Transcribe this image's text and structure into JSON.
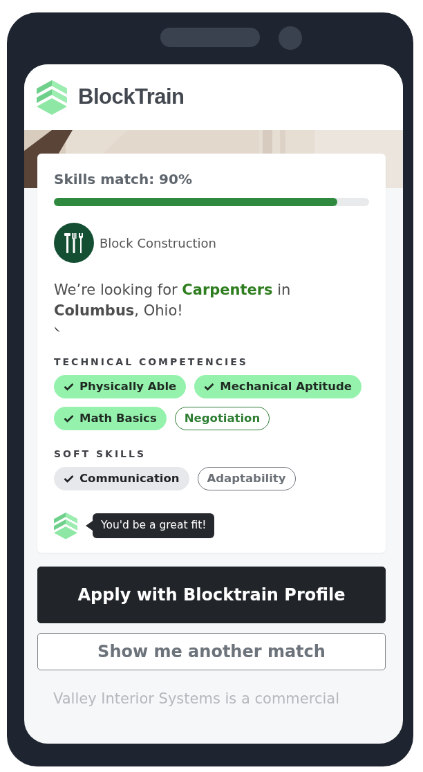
{
  "header": {
    "brand": "BlockTrain"
  },
  "match": {
    "label": "Skills match: 90%",
    "level": 0.9
  },
  "company": {
    "name": "Block Construction"
  },
  "headline": "We’re looking for **Carpenters** in **Columbus**, Ohio!",
  "sections": [
    {
      "kind": "technical",
      "title": "TECHNICAL COMPETENCIES",
      "skills": [
        {
          "label": "Physically Able",
          "checked": true
        },
        {
          "label": "Mechanical Aptitude",
          "checked": true
        },
        {
          "label": "Math Basics",
          "checked": true
        },
        {
          "label": "Negotiation",
          "checked": false
        }
      ]
    },
    {
      "kind": "soft",
      "title": "SOFT SKILLS",
      "skills": [
        {
          "label": "Communication",
          "checked": true
        },
        {
          "label": "Adaptability",
          "checked": false
        }
      ]
    }
  ],
  "tip": "You'd be a great fit!",
  "buttons": [
    {
      "kind": "primary",
      "label": "Apply with Blocktrain Profile"
    },
    {
      "kind": "outline",
      "label": "Show me another match"
    }
  ],
  "behind_text": "Valley Interior Systems is a commercial"
}
